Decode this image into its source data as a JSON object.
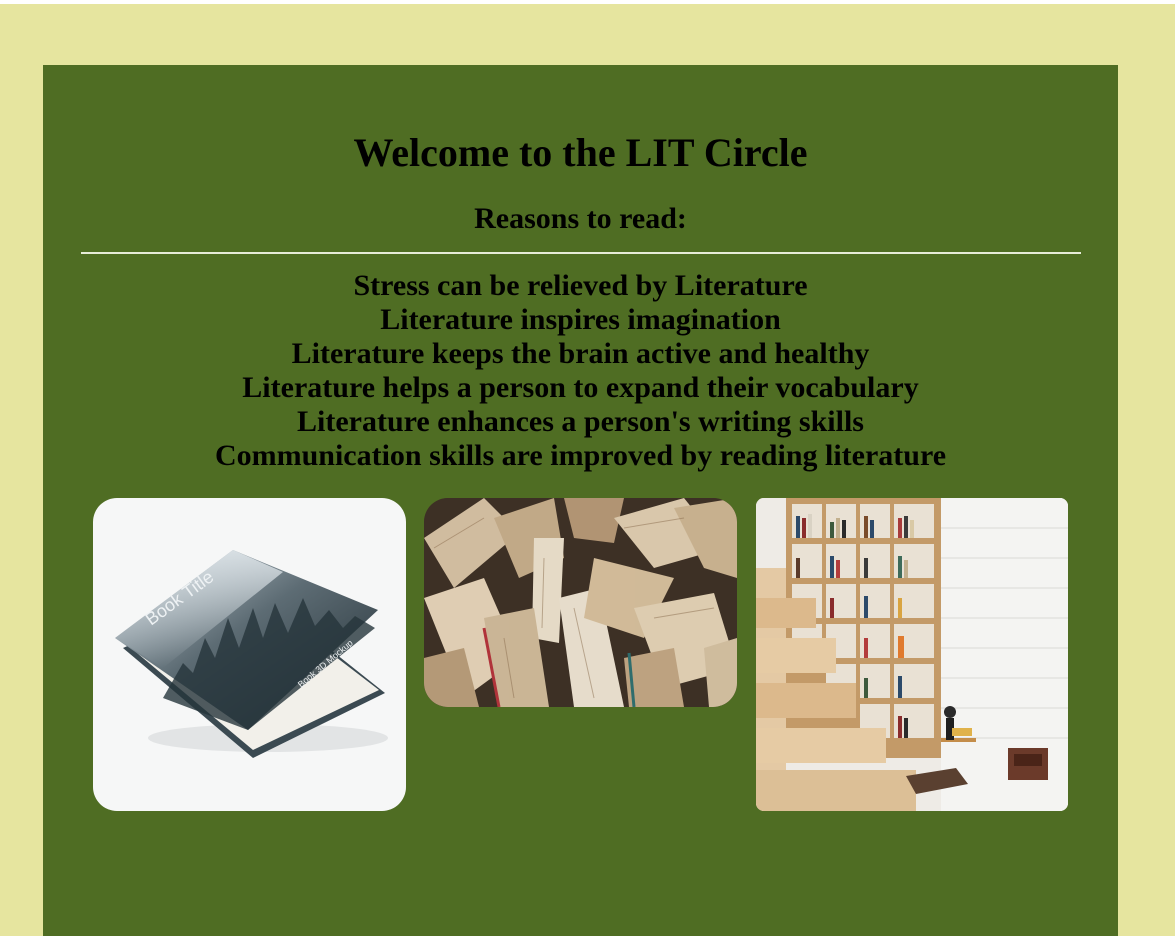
{
  "page": {
    "title": "Welcome to the LIT Circle",
    "subtitle": "Reasons to read:"
  },
  "reasons": [
    "Stress can be relieved by Literature",
    "Literature inspires imagination",
    "Literature keeps the brain active and healthy",
    "Literature helps a person to expand their vocabulary",
    "Literature enhances a person's writing skills",
    "Communication skills are improved by reading literature"
  ],
  "images": {
    "book_mockup": {
      "cover_title": "Book Title",
      "spine_text": "Book 3D Mockup"
    }
  },
  "colors": {
    "background": "#e6e59f",
    "panel": "#4f6d23",
    "text": "#000000"
  }
}
